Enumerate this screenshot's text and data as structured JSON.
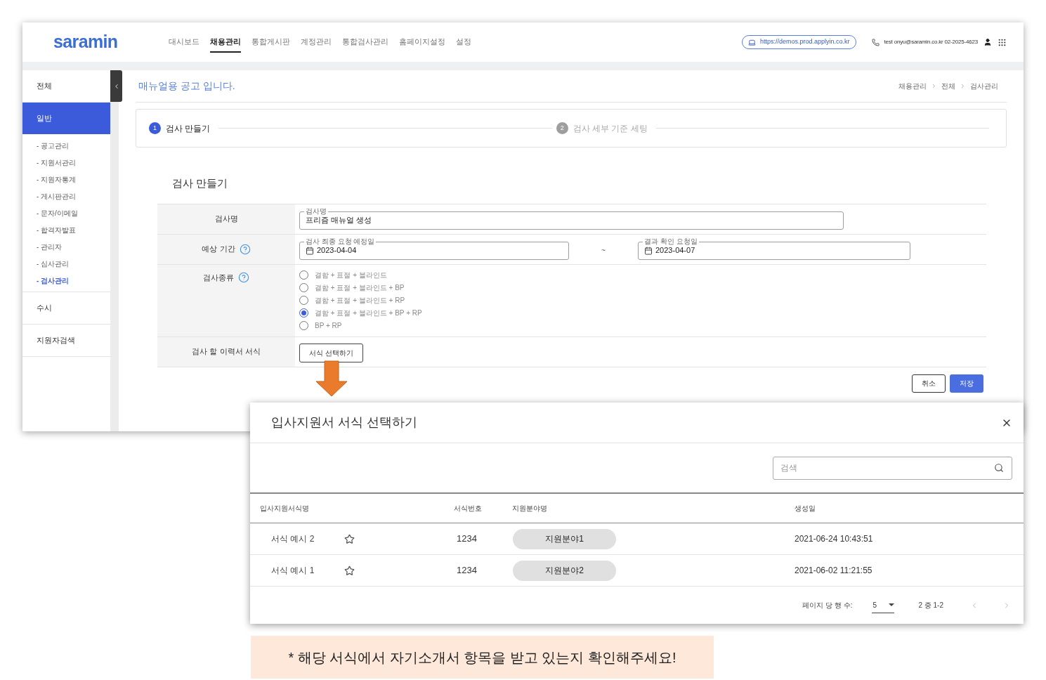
{
  "header": {
    "logo": "saramin",
    "nav": [
      {
        "label": "대시보드",
        "selected": false
      },
      {
        "label": "채용관리",
        "selected": true
      },
      {
        "label": "통합게시판",
        "selected": false
      },
      {
        "label": "계정관리",
        "selected": false
      },
      {
        "label": "통합검사관리",
        "selected": false
      },
      {
        "label": "홈페이지설정",
        "selected": false
      },
      {
        "label": "설정",
        "selected": false
      }
    ],
    "url": "https://demos.prod.applyin.co.kr",
    "contact": "test onyu@saramin.co.kr 02-2025-4623"
  },
  "sidebar": {
    "items": [
      {
        "label": "전체",
        "selected": false
      },
      {
        "label": "일반",
        "selected": true,
        "children": [
          {
            "label": "- 공고관리",
            "selected": false
          },
          {
            "label": "- 지원서관리",
            "selected": false
          },
          {
            "label": "- 지원자통계",
            "selected": false
          },
          {
            "label": "- 게시판관리",
            "selected": false
          },
          {
            "label": "- 문자/이메일",
            "selected": false
          },
          {
            "label": "- 합격자발표",
            "selected": false
          },
          {
            "label": "- 관리자",
            "selected": false
          },
          {
            "label": "- 심사관리",
            "selected": false
          },
          {
            "label": "- 검사관리",
            "selected": true
          }
        ]
      },
      {
        "label": "수시",
        "selected": false
      },
      {
        "label": "지원자검색",
        "selected": false
      }
    ]
  },
  "page_title": "매뉴얼용 공고 입니다.",
  "breadcrumb": [
    "채용관리",
    "전체",
    "검사관리"
  ],
  "steps": [
    {
      "number": "1",
      "label": "검사 만들기",
      "selected": true
    },
    {
      "number": "2",
      "label": "검사 세부 기준 세팅",
      "selected": false
    }
  ],
  "form": {
    "title": "검사 만들기",
    "rows": [
      {
        "kind": "text",
        "label": "검사명",
        "help": false,
        "field_label": "검사명",
        "value": "프리즘 매뉴얼 생성"
      },
      {
        "kind": "daterange",
        "label": "예상 기간",
        "help": true,
        "start_label": "검사 최종 요청 예정일",
        "start": "2023-04-04",
        "separator": "~",
        "end_label": "결과 확인 요청일",
        "end": "2023-04-07"
      },
      {
        "kind": "radio",
        "label": "검사종류",
        "help": true,
        "options": [
          {
            "label": "결함 + 표절 + 블라인드",
            "selected": false
          },
          {
            "label": "결함 + 표절 + 블라인드 + BP",
            "selected": false
          },
          {
            "label": "결함 + 표절 + 블라인드 + RP",
            "selected": false
          },
          {
            "label": "결함 + 표절 + 블라인드 + BP + RP",
            "selected": true
          },
          {
            "label": "BP + RP",
            "selected": false
          }
        ]
      },
      {
        "kind": "button",
        "label": "검사 할 이력서 서식",
        "help": false,
        "button": "서식 선택하기"
      }
    ],
    "cancel": "취소",
    "save": "저장"
  },
  "dialog": {
    "title": "입사지원서 서식 선택하기",
    "search": {
      "placeholder": "검색"
    },
    "columns": [
      "입사지원서식명",
      "서식번호",
      "지원분야명",
      "생성일"
    ],
    "rows": [
      {
        "name": "서식 예시 2",
        "starred": false,
        "number": "1234",
        "field": "지원분야1",
        "created": "2021-06-24 10:43:51"
      },
      {
        "name": "서식 예시 1",
        "starred": false,
        "number": "1234",
        "field": "지원분야2",
        "created": "2021-06-02 11:21:55"
      }
    ],
    "rows_per_page_label": "페이지 당 행 수:",
    "rows_per_page": "5",
    "range": "2 중 1-2"
  },
  "note": "* 해당 서식에서 자기소개서 항목을 받고 있는지 확인해주세요!"
}
